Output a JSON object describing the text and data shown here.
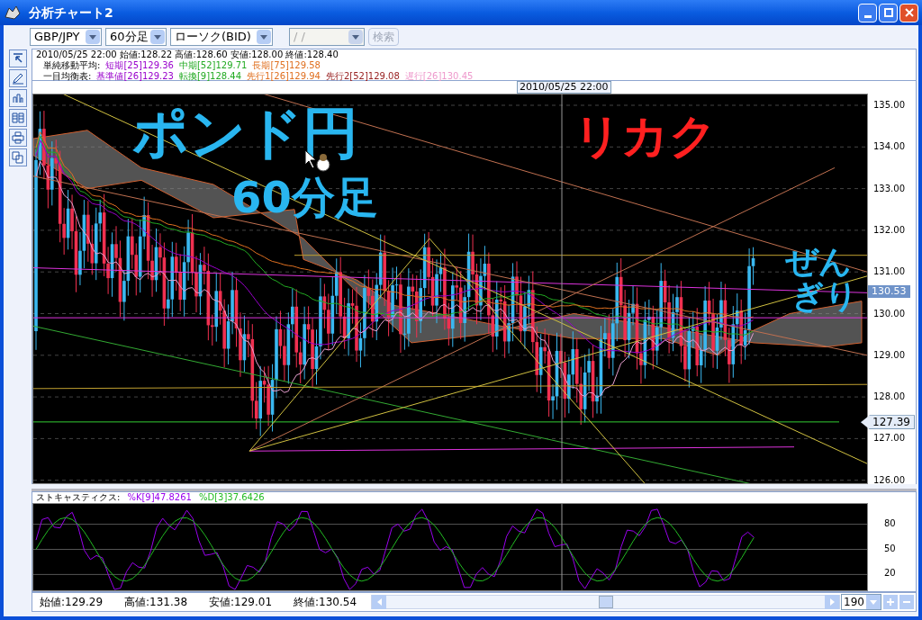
{
  "window": {
    "title": "分析チャート2"
  },
  "toolbar": {
    "pair": "GBP/JPY",
    "timeframe": "60分足",
    "chart_type": "ローソク(BID)",
    "date": "/ /",
    "date_disabled": true,
    "search_button": {
      "label": "検索",
      "disabled": true
    }
  },
  "info": {
    "bar": "2010/05/25 22:00 始値:128.22 高値:128.60 安値:128.00 終値:128.40",
    "sma": {
      "label": "単純移動平均:",
      "items": [
        {
          "text": "短期[25]129.36",
          "color": "#9900cc"
        },
        {
          "text": "中期[52]129.71",
          "color": "#22aa22"
        },
        {
          "text": "長期[75]129.58",
          "color": "#e07020"
        }
      ]
    },
    "ichimoku": {
      "label": "一目均衡表:",
      "items": [
        {
          "text": "基準値[26]129.23",
          "color": "#9900cc"
        },
        {
          "text": "転換[9]128.44",
          "color": "#22aa22"
        },
        {
          "text": "先行1[26]129.94",
          "color": "#e07020"
        },
        {
          "text": "先行2[52]129.08",
          "color": "#992222"
        },
        {
          "text": "遅行[26]130.45",
          "color": "#ee99cc"
        }
      ]
    }
  },
  "cursor_time": "2010/05/25 22:00",
  "price_axis": [
    "135.00",
    "134.00",
    "133.00",
    "132.00",
    "131.00",
    "130.00",
    "129.00",
    "128.00",
    "127.00",
    "126.00"
  ],
  "current_price": "130.53",
  "line_price": "127.39",
  "annotations": [
    {
      "text": "ポンド円",
      "color": "#29b6f0"
    },
    {
      "text": "60分足",
      "color": "#29b6f0"
    },
    {
      "text": "リカク",
      "color": "#ff2020"
    },
    {
      "text": "ぜん",
      "color": "#29b6f0"
    },
    {
      "text": "ぎり",
      "color": "#29b6f0"
    }
  ],
  "stochastic": {
    "label": "ストキャスティクス:",
    "items": [
      {
        "text": "%K[9]47.8261",
        "color": "#9900ee"
      },
      {
        "text": "%D[3]37.6426",
        "color": "#22bb22"
      }
    ],
    "axis": [
      "80",
      "50",
      "20"
    ]
  },
  "status": [
    "始値:129.29",
    "高値:131.38",
    "安値:129.01",
    "終値:130.54"
  ],
  "bar_count": "190"
}
